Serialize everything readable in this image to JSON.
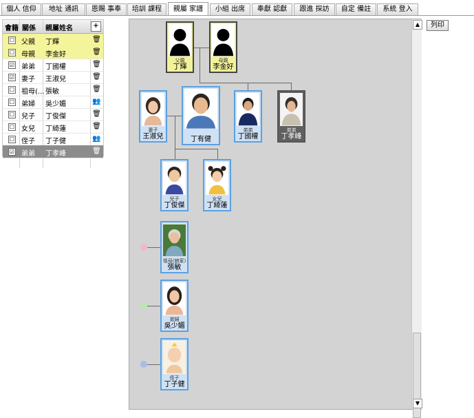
{
  "tabs": [
    "個人 信仰",
    "地址 通訊",
    "恩賜 事奉",
    "培訓 課程",
    "親屬 家譜",
    "小組 出席",
    "奉獻 認獻",
    "跟進 探訪",
    "自定 備註",
    "系統 登入"
  ],
  "active_tab": 4,
  "list": {
    "headers": {
      "member": "會籍",
      "relation": "關係",
      "name": "親屬姓名",
      "add": "+"
    },
    "rows": [
      {
        "checked": "☐",
        "relation": "父親",
        "name": "丁輝",
        "icon": "edit-icon"
      },
      {
        "checked": "☐",
        "relation": "母親",
        "name": "李金好",
        "icon": "edit-icon"
      },
      {
        "checked": "☑",
        "relation": "弟弟",
        "name": "丁國權",
        "icon": "edit-icon"
      },
      {
        "checked": "☑",
        "relation": "妻子",
        "name": "王淑兒",
        "icon": "edit-icon"
      },
      {
        "checked": "☐",
        "relation": "祖母(...",
        "name": "張敏",
        "icon": "edit-icon"
      },
      {
        "checked": "☐",
        "relation": "弟婦",
        "name": "吳少媚",
        "icon": "people-icon"
      },
      {
        "checked": "☐",
        "relation": "兒子",
        "name": "丁俊傑",
        "icon": "edit-icon"
      },
      {
        "checked": "☐",
        "relation": "女兒",
        "name": "丁綺蓮",
        "icon": "edit-icon"
      },
      {
        "checked": "☐",
        "relation": "侄子",
        "name": "丁子健",
        "icon": "people-icon"
      },
      {
        "checked": "☑",
        "relation": "弟弟",
        "name": "丁孝峰",
        "icon": "edit-icon"
      }
    ]
  },
  "print_label": "列印",
  "tree": {
    "father": {
      "role": "父親",
      "name": "丁輝"
    },
    "mother": {
      "role": "母親",
      "name": "李金好"
    },
    "wife": {
      "role": "妻子",
      "name": "王淑兒"
    },
    "self": {
      "role": "",
      "name": "丁有健"
    },
    "brother1": {
      "role": "弟弟",
      "name": "丁國權"
    },
    "brother2": {
      "role": "弟弟",
      "name": "丁孝峰"
    },
    "son": {
      "role": "兒子",
      "name": "丁俊傑"
    },
    "daughter": {
      "role": "女兒",
      "name": "丁綺蓮"
    },
    "grandma": {
      "role": "祖母(娘家)",
      "name": "張敏"
    },
    "sisterinlaw": {
      "role": "弟婦",
      "name": "吳少媚"
    },
    "nephew": {
      "role": "侄子",
      "name": "丁子健"
    }
  },
  "colors": {
    "accent": "#5aa0e0",
    "highlight": "#f4f49a",
    "selected": "#8c8c8c",
    "dot_pink": "#f0b8c8",
    "dot_green": "#b8e8b0",
    "dot_blue": "#a8bce8"
  }
}
